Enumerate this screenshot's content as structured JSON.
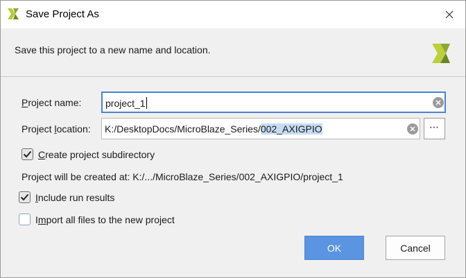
{
  "window": {
    "title": "Save Project As",
    "close_icon": "close-icon"
  },
  "header": {
    "description": "Save this project to a new name and location.",
    "logo_icon": "vivado-logo-icon"
  },
  "form": {
    "project_name": {
      "label_prefix": "P",
      "label_rest": "roject name:",
      "value": "project_1"
    },
    "project_location": {
      "label_prefix": "Project ",
      "label_ul": "l",
      "label_rest": "ocation:",
      "value_plain": "K:/DesktopDocs/MicroBlaze_Series/",
      "value_selected": "002_AXIGPIO",
      "browse_label": "⋯"
    },
    "create_subdir": {
      "label_ul": "C",
      "label_rest": "reate project subdirectory",
      "checked": true
    },
    "created_at": "Project will be created at: K:/.../MicroBlaze_Series/002_AXIGPIO/project_1",
    "include_run_results": {
      "label_ul": "I",
      "label_rest": "nclude run results",
      "checked": true
    },
    "import_all_files": {
      "label_prefix": "I",
      "label_ul": "m",
      "label_rest": "port all files to the new project",
      "checked": false
    }
  },
  "buttons": {
    "ok": "OK",
    "cancel": "Cancel"
  },
  "colors": {
    "accent": "#5b94e0",
    "focus_border": "#4a82d4",
    "selection": "#c7dcf2"
  }
}
